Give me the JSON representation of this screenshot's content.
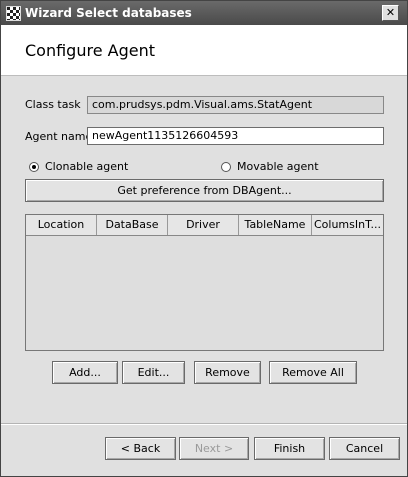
{
  "window": {
    "title": "Wizard Select databases",
    "close_glyph": "✕"
  },
  "header": {
    "title": "Configure Agent"
  },
  "form": {
    "class_task_label": "Class task",
    "class_task_value": "com.prudsys.pdm.Visual.ams.StatAgent",
    "agent_name_label": "Agent name",
    "agent_name_value": "newAgent1135126604593"
  },
  "radios": [
    {
      "label": "Clonable agent",
      "selected": true
    },
    {
      "label": "Movable agent",
      "selected": false
    }
  ],
  "preference_button": "Get preference from DBAgent...",
  "table": {
    "columns": [
      "Location",
      "DataBase",
      "Driver",
      "TableName",
      "ColumsInT..."
    ],
    "rows": []
  },
  "table_buttons": {
    "add": "Add...",
    "edit": "Edit...",
    "remove": "Remove",
    "remove_all": "Remove All"
  },
  "nav_buttons": {
    "back": "< Back",
    "next": "Next >",
    "finish": "Finish",
    "cancel": "Cancel"
  }
}
